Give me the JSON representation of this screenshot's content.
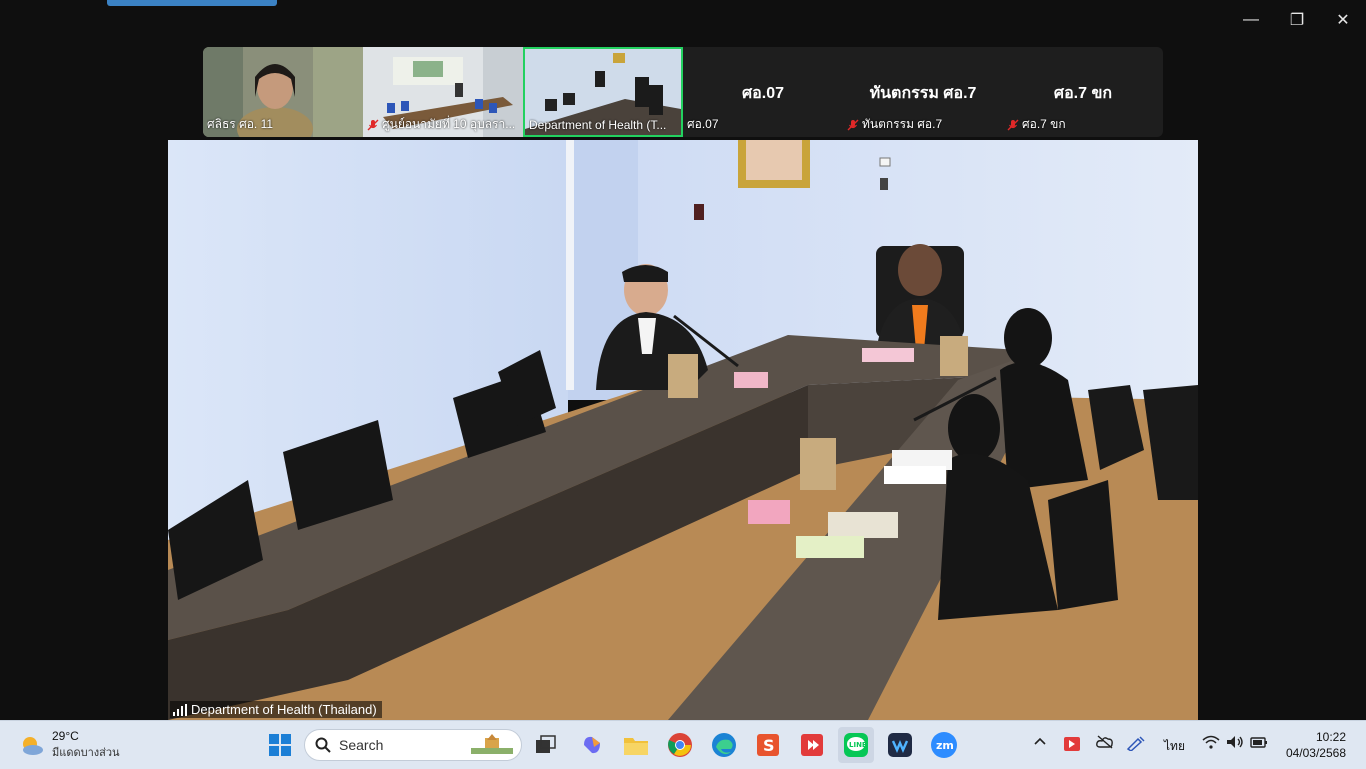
{
  "window": {
    "minimize": "—",
    "restore": "❐",
    "close": "✕"
  },
  "gallery": {
    "tiles": [
      {
        "name": "ศลิธร ศอ. 11",
        "kind": "video"
      },
      {
        "name": "ศูนย์อนามัยที่ 10 อุบลรา...",
        "kind": "video",
        "muted": true
      },
      {
        "name": "Department of Health (T...",
        "kind": "video",
        "active": true
      },
      {
        "name": "ศอ.07",
        "big": "ศอ.07",
        "kind": "name"
      },
      {
        "name": "ทันตกรรม ศอ.7",
        "big": "ทันตกรรม ศอ.7",
        "kind": "name",
        "muted": true
      },
      {
        "name": "ศอ.7 ขก",
        "big": "ศอ.7 ขก",
        "kind": "name",
        "muted": true
      }
    ]
  },
  "main": {
    "speaker_name": "Department of Health (Thailand)"
  },
  "taskbar": {
    "weather": {
      "temp": "29°C",
      "desc": "มีแดดบางส่วน"
    },
    "search_placeholder": "Search",
    "language": "ไทย",
    "time": "10:22",
    "date": "04/03/2568"
  },
  "colors": {
    "active_border": "#23d160",
    "taskbar_bg": "#dfe7f2",
    "muted_red": "#e02828"
  }
}
